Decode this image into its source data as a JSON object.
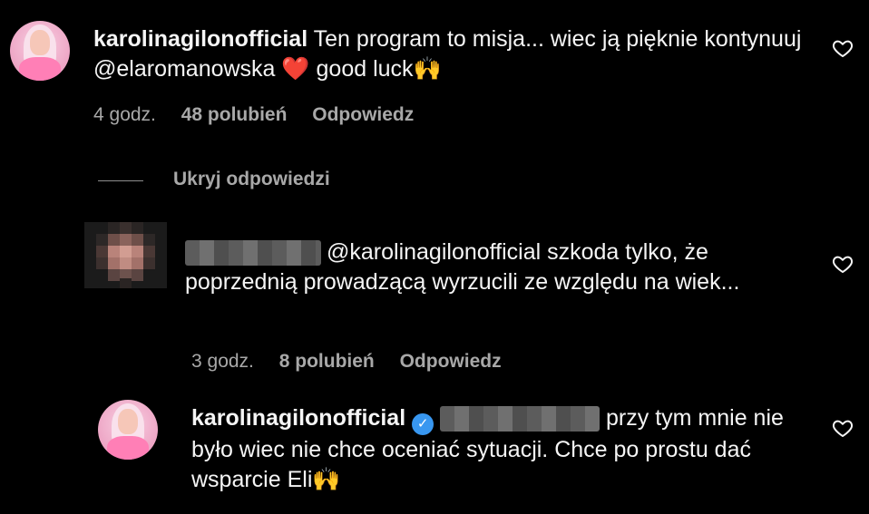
{
  "comment1": {
    "username": "karolinagilonofficial",
    "text_part1": "Ten program to misja... wiec ją pięknie kontynuuj @elaromanowska",
    "emoji_heart": "❤️",
    "text_part2": "good luck",
    "emoji_hands": "🙌",
    "time": "4 godz.",
    "likes": "48 polubień",
    "reply": "Odpowiedz"
  },
  "hide_replies": "Ukryj odpowiedzi",
  "reply1": {
    "text": "@karolinagilonofficial szkoda tylko, że poprzednią prowadzącą wyrzucili ze względu na wiek...",
    "time": "3 godz.",
    "likes": "8 polubień",
    "reply": "Odpowiedz"
  },
  "reply2": {
    "username": "karolinagilonofficial",
    "verified_icon": "✓",
    "text": "przy tym mnie nie było wiec nie chce oceniać sytuacji. Chce po prostu dać wsparcie Eli",
    "emoji_hands": "🙌"
  },
  "colors": {
    "background": "#000000",
    "meta_gray": "#a8a8a8",
    "verified_blue": "#3897f0",
    "heart_red": "#e8232e"
  }
}
